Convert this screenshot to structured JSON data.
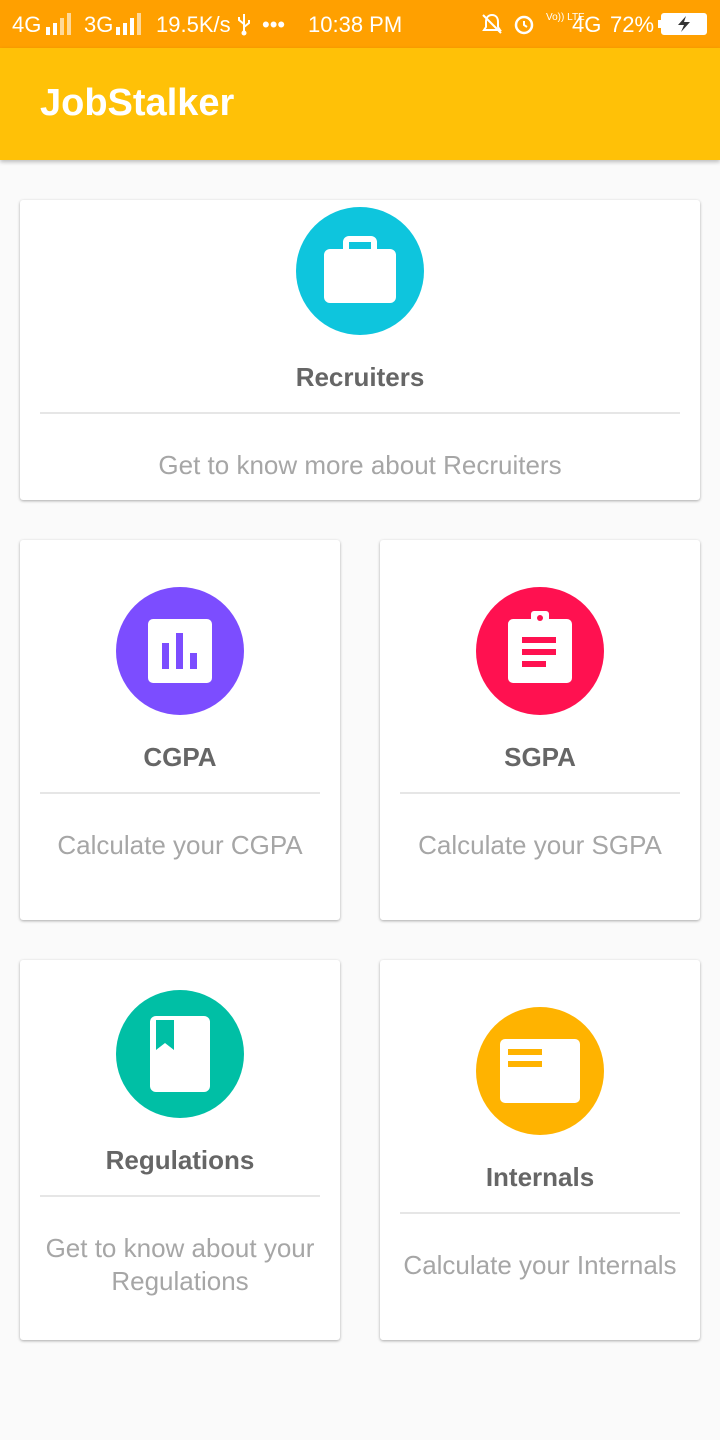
{
  "status_bar": {
    "network1": "4G",
    "network2": "3G",
    "speed": "19.5K/s",
    "dots": "•••",
    "time": "10:38 PM",
    "volte": "Vo)) LTE",
    "network3": "4G",
    "battery": "72%"
  },
  "app": {
    "title": "JobStalker"
  },
  "cards": {
    "recruiters": {
      "title": "Recruiters",
      "description": "Get to know more about Recruiters",
      "icon": "briefcase-icon",
      "color": "#0ec5dd"
    },
    "cgpa": {
      "title": "CGPA",
      "description": "Calculate your CGPA",
      "icon": "bar-chart-icon",
      "color": "#7c4dff"
    },
    "sgpa": {
      "title": "SGPA",
      "description": "Calculate your SGPA",
      "icon": "clipboard-icon",
      "color": "#ff1150"
    },
    "regulations": {
      "title": "Regulations",
      "description": "Get to know about your Regulations",
      "icon": "book-icon",
      "color": "#00bfa5"
    },
    "internals": {
      "title": "Internals",
      "description": "Calculate your Internals",
      "icon": "card-icon",
      "color": "#ffb300"
    }
  }
}
